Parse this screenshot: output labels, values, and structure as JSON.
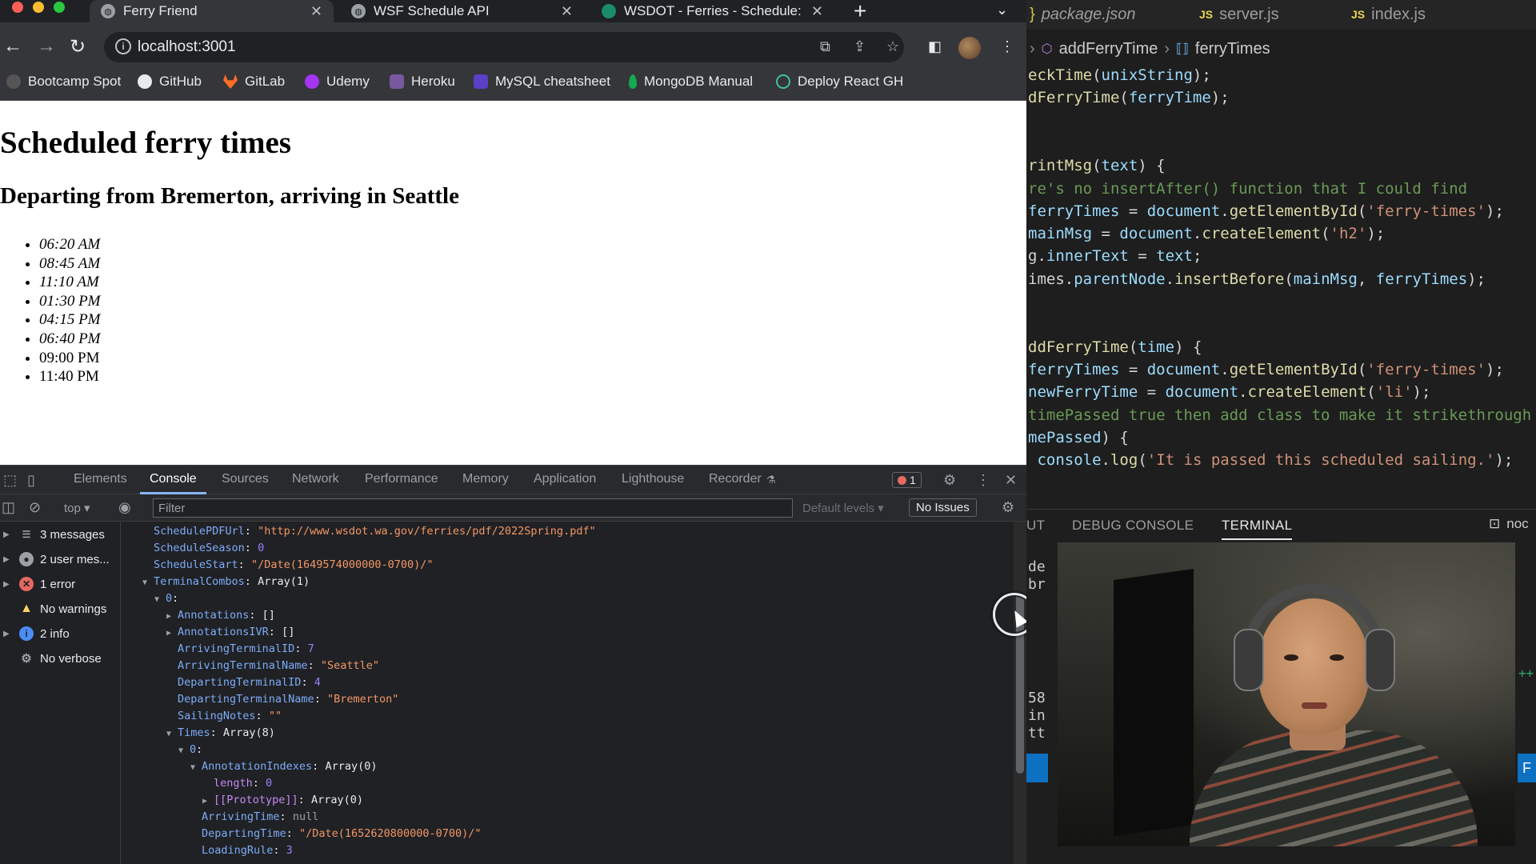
{
  "browser": {
    "tabs": [
      {
        "title": "Ferry Friend",
        "active": true
      },
      {
        "title": "WSF Schedule API",
        "active": false
      },
      {
        "title": "WSDOT - Ferries - Schedule: S",
        "active": false
      }
    ],
    "url": "localhost:3001",
    "bookmarks": [
      "Bootcamp Spot",
      "GitHub",
      "GitLab",
      "Udemy",
      "Heroku",
      "MySQL cheatsheet",
      "MongoDB Manual",
      "Deploy React GH"
    ]
  },
  "page": {
    "title": "Scheduled ferry times",
    "subtitle": "Departing from Bremerton, arriving in Seattle",
    "times": [
      {
        "time": "06:20 AM",
        "passed": true
      },
      {
        "time": "08:45 AM",
        "passed": true
      },
      {
        "time": "11:10 AM",
        "passed": true
      },
      {
        "time": "01:30 PM",
        "passed": true
      },
      {
        "time": "04:15 PM",
        "passed": true
      },
      {
        "time": "06:40 PM",
        "passed": true
      },
      {
        "time": "09:00 PM",
        "passed": false
      },
      {
        "time": "11:40 PM",
        "passed": false
      }
    ]
  },
  "devtools": {
    "tabs": [
      "Elements",
      "Console",
      "Sources",
      "Network",
      "Performance",
      "Memory",
      "Application",
      "Lighthouse",
      "Recorder"
    ],
    "active_tab": "Console",
    "error_count": "1",
    "context": "top",
    "filter_placeholder": "Filter",
    "levels": "Default levels",
    "issues": "No Issues",
    "sidebar": [
      {
        "label": "3 messages",
        "icon": "list-icon"
      },
      {
        "label": "2 user mes...",
        "icon": "user-icon"
      },
      {
        "label": "1 error",
        "icon": "error-icon"
      },
      {
        "label": "No warnings",
        "icon": "warning-icon"
      },
      {
        "label": "2 info",
        "icon": "info-icon"
      },
      {
        "label": "No verbose",
        "icon": "gear-icon"
      }
    ],
    "console_lines": [
      {
        "key": "SchedulePDFUrl",
        "value": "\"http://www.wsdot.wa.gov/ferries/pdf/2022Spring.pdf\"",
        "type": "string"
      },
      {
        "key": "ScheduleSeason",
        "value": "0",
        "type": "number"
      },
      {
        "key": "ScheduleStart",
        "value": "\"/Date(1649574000000-0700)/\"",
        "type": "string"
      },
      {
        "key": "TerminalCombos",
        "value": "Array(1)",
        "type": "plain"
      },
      {
        "key": "0",
        "value": "",
        "type": "plain"
      },
      {
        "key": "Annotations",
        "value": "[]",
        "type": "plain"
      },
      {
        "key": "AnnotationsIVR",
        "value": "[]",
        "type": "plain"
      },
      {
        "key": "ArrivingTerminalID",
        "value": "7",
        "type": "number"
      },
      {
        "key": "ArrivingTerminalName",
        "value": "\"Seattle\"",
        "type": "string"
      },
      {
        "key": "DepartingTerminalID",
        "value": "4",
        "type": "number"
      },
      {
        "key": "DepartingTerminalName",
        "value": "\"Bremerton\"",
        "type": "string"
      },
      {
        "key": "SailingNotes",
        "value": "\"\"",
        "type": "string"
      },
      {
        "key": "Times",
        "value": "Array(8)",
        "type": "plain"
      },
      {
        "key": "0",
        "value": "",
        "type": "plain"
      },
      {
        "key": "AnnotationIndexes",
        "value": "Array(0)",
        "type": "plain"
      },
      {
        "key": "length",
        "value": "0",
        "type": "number"
      },
      {
        "key": "[[Prototype]]",
        "value": "Array(0)",
        "type": "plain"
      },
      {
        "key": "ArrivingTime",
        "value": "null",
        "type": "null"
      },
      {
        "key": "DepartingTime",
        "value": "\"/Date(1652620800000-0700)/\"",
        "type": "string"
      },
      {
        "key": "LoadingRule",
        "value": "3",
        "type": "number"
      }
    ]
  },
  "vscode": {
    "tabs": [
      "package.json",
      "server.js",
      "index.js"
    ],
    "breadcrumb": [
      "addFerryTime",
      "ferryTimes"
    ],
    "code": [
      "eckTime(unixString);",
      "dFerryTime(ferryTime);",
      "",
      "",
      "rintMsg(text) {",
      "re's no insertAfter() function that I could find",
      "ferryTimes = document.getElementById('ferry-times');",
      "mainMsg = document.createElement('h2');",
      "g.innerText = text;",
      "imes.parentNode.insertBefore(mainMsg, ferryTimes);",
      "",
      "",
      "ddFerryTime(time) {",
      "ferryTimes = document.getElementById('ferry-times');",
      "newFerryTime = document.createElement('li');",
      "timePassed true then add class to make it strikethrough",
      "mePassed) {",
      " console.log('It is passed this scheduled sailing.');"
    ],
    "panel_tabs": [
      "UT",
      "DEBUG CONSOLE",
      "TERMINAL"
    ],
    "active_panel_tab": "TERMINAL",
    "panel_right": "noc",
    "terminal_fragments": [
      "de",
      "br",
      "",
      "",
      "",
      "",
      "58",
      "in",
      "tt"
    ]
  }
}
